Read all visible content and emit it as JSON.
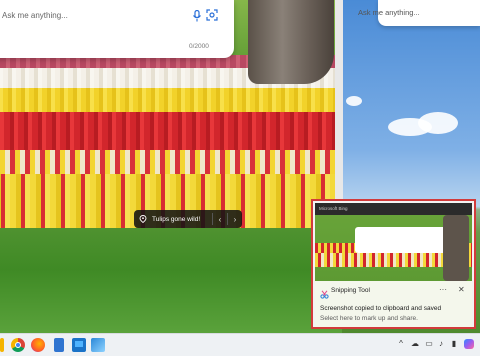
{
  "search": {
    "placeholder": "Ask me anything...",
    "counter": "0/2000",
    "mic_icon": "microphone-icon",
    "lens_icon": "visual-search-icon"
  },
  "top_right_input": {
    "placeholder": "Ask me anything..."
  },
  "caption": {
    "text": "Tulips gone wild!",
    "pin_icon": "location-pin-icon",
    "prev_icon": "chevron-left-icon",
    "next_icon": "chevron-right-icon"
  },
  "snip_preview": {
    "browser_label": "Microsoft Bing"
  },
  "toast": {
    "app_name": "Snipping Tool",
    "message": "Screenshot copied to clipboard and saved",
    "subtext": "Select here to mark up and share.",
    "more_label": "···",
    "close_label": "✕"
  },
  "taskbar": {
    "tray_chevron": "^",
    "icons": [
      "chrome-icon",
      "firefox-icon",
      "files-icon",
      "store-icon",
      "paint-icon"
    ]
  },
  "colors": {
    "toast_border": "#d23b3b",
    "taskbar_bg": "#eef1f4",
    "caption_bg": "#141414"
  }
}
